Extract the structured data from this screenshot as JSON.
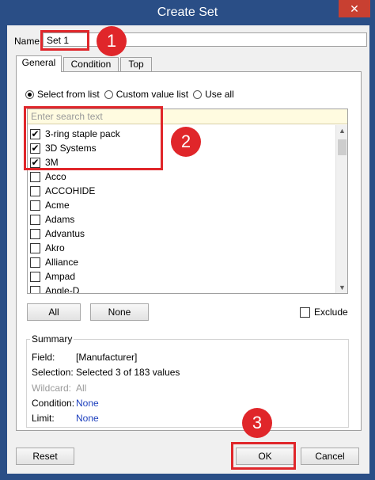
{
  "window": {
    "title": "Create Set",
    "close_glyph": "✕"
  },
  "name": {
    "label": "Name:",
    "value": "Set 1"
  },
  "tabs": [
    {
      "label": "General",
      "active": true
    },
    {
      "label": "Condition",
      "active": false
    },
    {
      "label": "Top",
      "active": false
    }
  ],
  "mode": {
    "options": [
      {
        "label": "Select from list",
        "selected": true
      },
      {
        "label": "Custom value list",
        "selected": false
      },
      {
        "label": "Use all",
        "selected": false
      }
    ]
  },
  "list": {
    "search_placeholder": "Enter search text",
    "items": [
      {
        "label": "3-ring staple pack",
        "checked": true
      },
      {
        "label": "3D Systems",
        "checked": true
      },
      {
        "label": "3M",
        "checked": true
      },
      {
        "label": "Acco",
        "checked": false
      },
      {
        "label": "ACCOHIDE",
        "checked": false
      },
      {
        "label": "Acme",
        "checked": false
      },
      {
        "label": "Adams",
        "checked": false
      },
      {
        "label": "Advantus",
        "checked": false
      },
      {
        "label": "Akro",
        "checked": false
      },
      {
        "label": "Alliance",
        "checked": false
      },
      {
        "label": "Ampad",
        "checked": false
      },
      {
        "label": "Angle-D",
        "checked": false
      }
    ]
  },
  "buttons": {
    "all": "All",
    "none": "None",
    "reset": "Reset",
    "ok": "OK",
    "cancel": "Cancel"
  },
  "exclude": {
    "label": "Exclude",
    "checked": false
  },
  "summary": {
    "title": "Summary",
    "rows": [
      {
        "key": "Field:",
        "value": "[Manufacturer]",
        "style": "normal"
      },
      {
        "key": "Selection:",
        "value": "Selected 3 of 183 values",
        "style": "normal"
      },
      {
        "key": "Wildcard:",
        "value": "All",
        "style": "gray"
      },
      {
        "key": "Condition:",
        "value": "None",
        "style": "blue"
      },
      {
        "key": "Limit:",
        "value": "None",
        "style": "blue"
      }
    ]
  },
  "callouts": [
    "1",
    "2",
    "3"
  ],
  "colors": {
    "title_bar": "#2a4e86",
    "callout": "#e0262a",
    "link": "#1c3fbd"
  }
}
